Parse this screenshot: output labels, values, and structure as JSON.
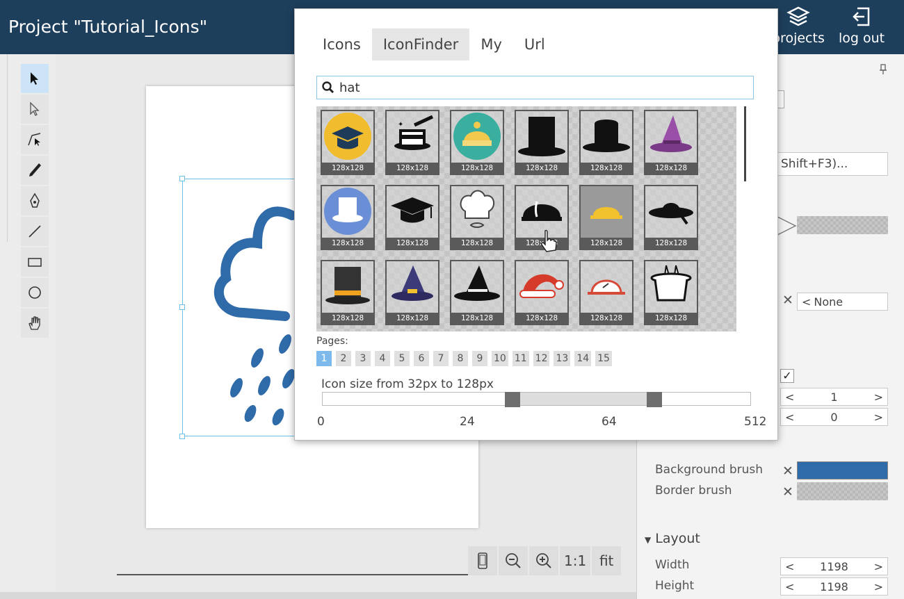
{
  "header": {
    "title": "Project \"Tutorial_Icons\"",
    "projects_label": "projects",
    "logout_label": "log out",
    "background": "#1e3f5c"
  },
  "toolbar": {
    "tools": [
      "select-arrow",
      "direct-select",
      "path-edit",
      "pencil",
      "pen",
      "line",
      "rectangle",
      "ellipse",
      "hand"
    ],
    "active": "select-arrow"
  },
  "zoom": {
    "one_to_one": "1:1",
    "fit": "fit"
  },
  "right_panel": {
    "shortcut_field": "Shift+F3)...",
    "none_label": "None",
    "stepper_1": "1",
    "stepper_0": "0",
    "background_brush_label": "Background brush",
    "border_brush_label": "Border brush",
    "background_brush_color": "#2f6aa9",
    "layout_header": "Layout",
    "width_label": "Width",
    "height_label": "Height",
    "width_value": "1198",
    "height_value": "1198"
  },
  "popup": {
    "tabs": [
      {
        "label": "Icons",
        "active": false
      },
      {
        "label": "IconFinder",
        "active": true
      },
      {
        "label": "My",
        "active": false
      },
      {
        "label": "Url",
        "active": false
      }
    ],
    "search_value": "hat",
    "tile_size_label": "128x128",
    "icons": [
      "graduation-cap-yellow-icon",
      "magic-hat-icon",
      "beanie-icon",
      "top-hat-icon",
      "bowler-hat-icon",
      "witch-hat-purple-icon",
      "top-hat-blue-circle-icon",
      "mortarboard-icon",
      "chef-hat-icon",
      "hard-hat-black-icon",
      "hard-hat-yellow-icon",
      "sun-hat-icon",
      "top-hat-band-icon",
      "wizard-hat-icon",
      "witch-hat-black-icon",
      "santa-hat-icon",
      "cap-icon",
      "magician-hat-icon"
    ],
    "pages_label": "Pages:",
    "pages": [
      "1",
      "2",
      "3",
      "4",
      "5",
      "6",
      "7",
      "8",
      "9",
      "10",
      "11",
      "12",
      "13",
      "14",
      "15"
    ],
    "active_page": "1",
    "size_label": "Icon size from 32px to 128px",
    "slider_ticks": [
      "0",
      "24",
      "64",
      "512"
    ]
  }
}
